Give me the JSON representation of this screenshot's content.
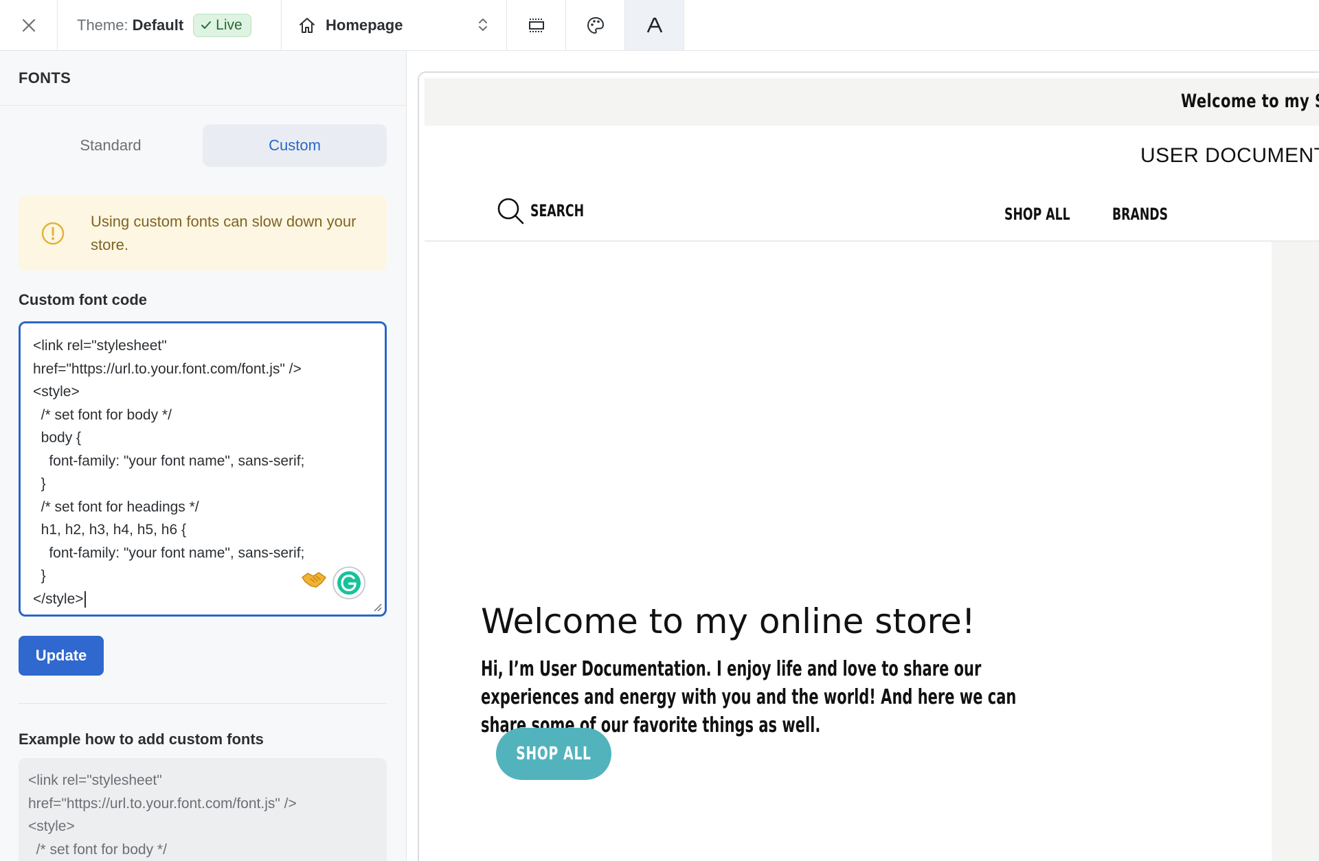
{
  "topbar": {
    "theme_label": "Theme:",
    "theme_value": "Default",
    "live_badge": "Live",
    "page_selector": "Homepage"
  },
  "sidebar": {
    "title": "FONTS",
    "tabs": [
      {
        "label": "Standard",
        "active": false
      },
      {
        "label": "Custom",
        "active": true
      }
    ],
    "warning": "Using custom fonts can slow down your store.",
    "custom_code_label": "Custom font code",
    "custom_code_value": "<link rel=\"stylesheet\"\nhref=\"https://url.to.your.font.com/font.js\" />\n<style>\n  /* set font for body */\n  body {\n    font-family: \"your font name\", sans-serif;\n  }\n  /* set font for headings */\n  h1, h2, h3, h4, h5, h6 {\n    font-family: \"your font name\", sans-serif;\n  }\n</style>",
    "update_button": "Update",
    "example_label": "Example how to add custom fonts",
    "example_code": "<link rel=\"stylesheet\"\nhref=\"https://url.to.your.font.com/font.js\" />\n<style>\n  /* set font for body */"
  },
  "preview": {
    "announcement": "Welcome to my Store",
    "store_name": "USER DOCUMENTATION",
    "nav": {
      "search": "SEARCH",
      "shop_all": "SHOP ALL",
      "brands": "BRANDS"
    },
    "hero": {
      "title": "Welcome to my online store!",
      "text": "Hi, I’m User Documentation. I enjoy life and love to share our experiences and energy with you and the world! And here we can share some of our favorite things as well.",
      "button": "SHOP ALL"
    }
  },
  "colors": {
    "accent_blue": "#2f68cf",
    "live_green": "#256b32",
    "warning_bg": "#fdf6e3",
    "hero_button": "#53b3bd"
  },
  "icons": [
    "close-icon",
    "check-icon",
    "home-icon",
    "chevron-updown-icon",
    "layout-icon",
    "palette-icon",
    "font-icon",
    "warning-icon",
    "handshake-icon",
    "grammarly-icon",
    "search-icon",
    "resize-handle-icon"
  ]
}
